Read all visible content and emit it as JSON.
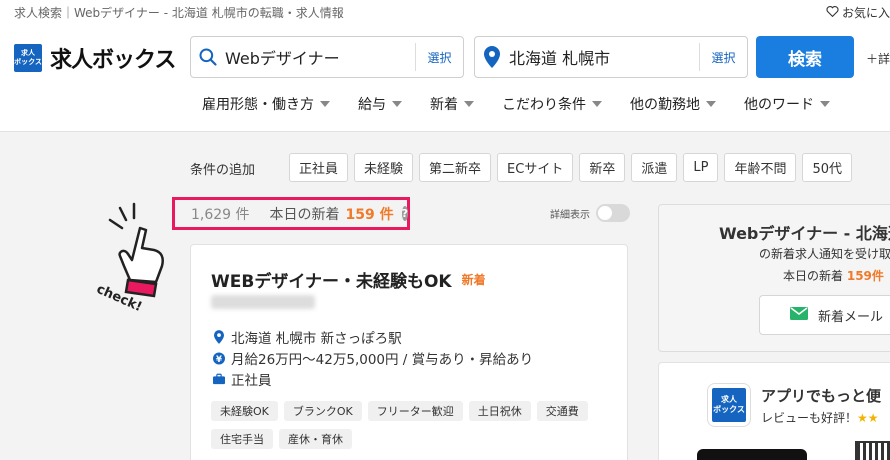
{
  "header": {
    "breadcrumb": "求人検索｜Webデザイナー - 北海道 札幌市の転職・求人情報",
    "favorite_label": "お気に入",
    "logo_badge_line1": "求人",
    "logo_badge_line2": "ボックス",
    "logo_text": "求人ボックス",
    "keyword_value": "Webデザイナー",
    "keyword_select": "選択",
    "area_value": "北海道 札幌市",
    "area_select": "選択",
    "search_button": "検索",
    "detail_link": "＋詳"
  },
  "filters": [
    {
      "label": "雇用形態・働き方"
    },
    {
      "label": "給与"
    },
    {
      "label": "新着"
    },
    {
      "label": "こだわり条件"
    },
    {
      "label": "他の勤務地"
    },
    {
      "label": "他のワード"
    }
  ],
  "conditions": {
    "label": "条件の追加",
    "tags": [
      "正社員",
      "未経験",
      "第二新卒",
      "ECサイト",
      "新卒",
      "派遣",
      "LP",
      "年齢不問",
      "50代"
    ]
  },
  "results": {
    "count": "1,629 件",
    "new_today_label": "本日の新着",
    "new_today_count": "159 件",
    "help": "?",
    "detail_toggle_label": "詳細表示"
  },
  "illustration": {
    "text": "check!"
  },
  "job": {
    "title": "WEBデザイナー・未経験もOK",
    "badge": "新着",
    "location": "北海道 札幌市 新さっぽろ駅",
    "salary": "月給26万円〜42万5,000円 / 賞与あり・昇給あり",
    "employment": "正社員",
    "tags": [
      "未経験OK",
      "ブランクOK",
      "フリーター歓迎",
      "土日祝休",
      "交通費",
      "住宅手当",
      "産休・育休"
    ]
  },
  "side_alert": {
    "title": "Webデザイナー - 北海道",
    "subtitle": "の新着求人通知を受け取",
    "new_label": "本日の新着",
    "new_count": "159件",
    "mail_button": "新着メール"
  },
  "side_app": {
    "icon_line1": "求人",
    "icon_line2": "ボックス",
    "title": "アプリでもっと便",
    "review_text": "レビューも好評！",
    "stars": "★★"
  },
  "colors": {
    "brand_blue": "#1565c0",
    "search_button": "#1a7ee0",
    "highlight_border": "#e8195e",
    "new_orange": "#f07a2a"
  }
}
